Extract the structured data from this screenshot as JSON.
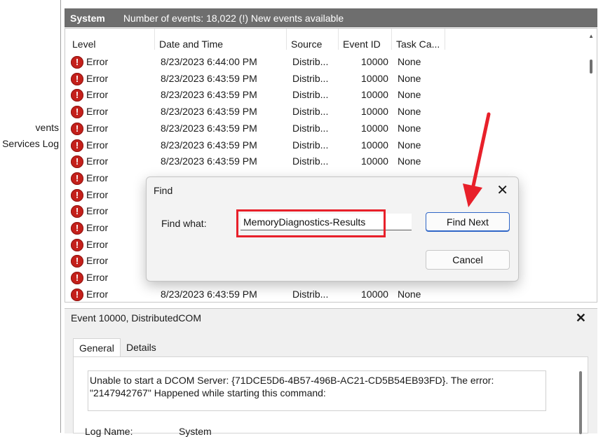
{
  "left_pane": {
    "items": [
      "vents",
      "d Services Log"
    ]
  },
  "header": {
    "title": "System",
    "info": "Number of events: 18,022 (!) New events available"
  },
  "events": {
    "columns": [
      "Level",
      "Date and Time",
      "Source",
      "Event ID",
      "Task Ca..."
    ],
    "rows": [
      {
        "level": "Error",
        "datetime": "8/23/2023 6:44:00 PM",
        "source": "Distrib...",
        "event_id": "10000",
        "task": "None"
      },
      {
        "level": "Error",
        "datetime": "8/23/2023 6:43:59 PM",
        "source": "Distrib...",
        "event_id": "10000",
        "task": "None"
      },
      {
        "level": "Error",
        "datetime": "8/23/2023 6:43:59 PM",
        "source": "Distrib...",
        "event_id": "10000",
        "task": "None"
      },
      {
        "level": "Error",
        "datetime": "8/23/2023 6:43:59 PM",
        "source": "Distrib...",
        "event_id": "10000",
        "task": "None"
      },
      {
        "level": "Error",
        "datetime": "8/23/2023 6:43:59 PM",
        "source": "Distrib...",
        "event_id": "10000",
        "task": "None"
      },
      {
        "level": "Error",
        "datetime": "8/23/2023 6:43:59 PM",
        "source": "Distrib...",
        "event_id": "10000",
        "task": "None"
      },
      {
        "level": "Error",
        "datetime": "8/23/2023 6:43:59 PM",
        "source": "Distrib...",
        "event_id": "10000",
        "task": "None"
      },
      {
        "level": "Error",
        "datetime": "",
        "source": "",
        "event_id": "",
        "task": ""
      },
      {
        "level": "Error",
        "datetime": "",
        "source": "",
        "event_id": "",
        "task": ""
      },
      {
        "level": "Error",
        "datetime": "",
        "source": "",
        "event_id": "",
        "task": ""
      },
      {
        "level": "Error",
        "datetime": "",
        "source": "",
        "event_id": "",
        "task": ""
      },
      {
        "level": "Error",
        "datetime": "",
        "source": "",
        "event_id": "",
        "task": ""
      },
      {
        "level": "Error",
        "datetime": "",
        "source": "",
        "event_id": "",
        "task": ""
      },
      {
        "level": "Error",
        "datetime": "",
        "source": "",
        "event_id": "",
        "task": ""
      },
      {
        "level": "Error",
        "datetime": "8/23/2023 6:43:59 PM",
        "source": "Distrib...",
        "event_id": "10000",
        "task": "None"
      }
    ]
  },
  "detail": {
    "title": "Event 10000, DistributedCOM",
    "tabs": [
      "General",
      "Details"
    ],
    "description": "Unable to start a DCOM Server: {71DCE5D6-4B57-496B-AC21-CD5B54EB93FD}. The error: \"2147942767\" Happened while starting this command:",
    "log_name_label": "Log Name:",
    "log_name_value": "System"
  },
  "find_dialog": {
    "title": "Find",
    "label": "Find what:",
    "input_value": "MemoryDiagnostics-Results",
    "find_next_label": "Find Next",
    "cancel_label": "Cancel"
  },
  "colors": {
    "header_bg": "#6e6e6e",
    "error_icon": "#c4201b",
    "annotation": "#e8202a",
    "primary_button_border": "#2f66c7"
  }
}
